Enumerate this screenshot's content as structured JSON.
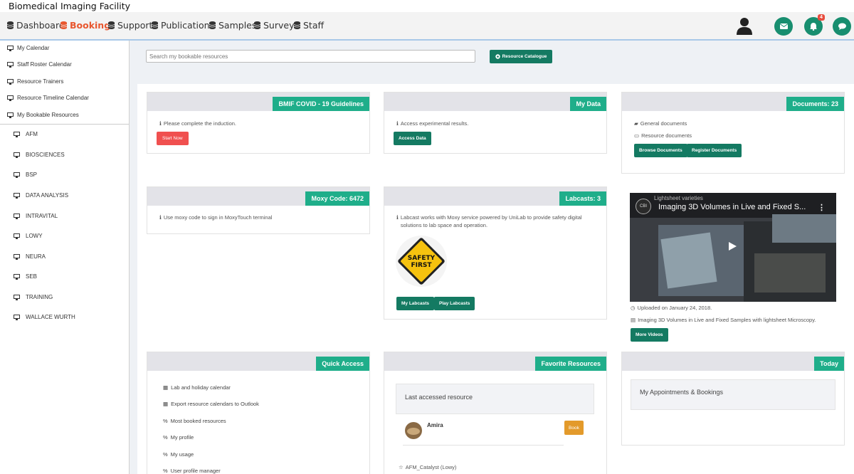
{
  "app_title": "Biomedical Imaging Facility",
  "nav": {
    "items": [
      {
        "label": "Dashboard",
        "icon": "database-icon"
      },
      {
        "label": "Booking",
        "icon": "database-icon",
        "active": true
      },
      {
        "label": "Support",
        "icon": "database-icon"
      },
      {
        "label": "Publications",
        "icon": "database-icon"
      },
      {
        "label": "Samples",
        "icon": "database-icon"
      },
      {
        "label": "Survey",
        "icon": "database-icon"
      },
      {
        "label": "Staff",
        "icon": "database-icon"
      }
    ],
    "notification_count": "4"
  },
  "sidebar": {
    "items": [
      "My Calendar",
      "Staff Roster Calendar",
      "Resource Trainers",
      "Resource Timeline Calendar",
      "My Bookable Resources"
    ],
    "resources": [
      "AFM",
      "BIOSCIENCES",
      "BSP",
      "DATA ANALYSIS",
      "INTRAVITAL",
      "LOWY",
      "NEURA",
      "SEB",
      "TRAINING",
      "WALLACE WURTH"
    ]
  },
  "search": {
    "placeholder": "Search my bookable resources",
    "catalogue_label": "Resource Catalogue"
  },
  "cards": {
    "covid": {
      "tag": "BMIF COVID - 19 Guidelines",
      "text": "Please complete the induction.",
      "button": "Start Now"
    },
    "mydata": {
      "tag": "My Data",
      "text": "Access experimental results.",
      "button": "Access Data"
    },
    "documents": {
      "tag": "Documents: 23",
      "general": "General documents",
      "resource": "Resource documents",
      "browse": "Browse Documents",
      "register": "Register Documents"
    },
    "moxy": {
      "tag": "Moxy Code: 6472",
      "text": "Use moxy code to sign in MoxyTouch terminal"
    },
    "labcasts": {
      "tag": "Labcasts: 3",
      "text": "Labcast works with Moxy service powered by UniLab to provide safety digital solutions to lab space and operation.",
      "safety_line1": "SAFETY",
      "safety_line2": "FIRST",
      "my_labcasts": "My Labcasts",
      "play_labcasts": "Play Labcasts"
    },
    "video": {
      "channel": "Lightsheet varieties",
      "title": "Imaging 3D Volumes in Live and Fixed S...",
      "uploaded": "Uploaded on January 24, 2018.",
      "description": "Imaging 3D Volumes in Live and Fixed Samples with lightsheet Microscopy.",
      "button": "More Videos",
      "logo_text": "CBI"
    },
    "quick_access": {
      "tag": "Quick Access",
      "items": [
        "Lab and holiday calendar",
        "Export resource calendars to Outlook",
        "Most booked resources",
        "My profile",
        "My usage",
        "User profile manager"
      ]
    },
    "favorites": {
      "tag": "Favorite Resources",
      "last_accessed_label": "Last accessed resource",
      "resource_name": "Amira",
      "book_label": "Book",
      "favorite_item": "AFM_Catalyst (Lowy)"
    },
    "today": {
      "tag": "Today",
      "appointments": "My Appointments & Bookings"
    }
  },
  "colors": {
    "primary": "#147a62",
    "accent": "#1fae8a",
    "active_nav": "#e8572f",
    "danger": "#f0504f",
    "warning": "#e39a2b"
  }
}
